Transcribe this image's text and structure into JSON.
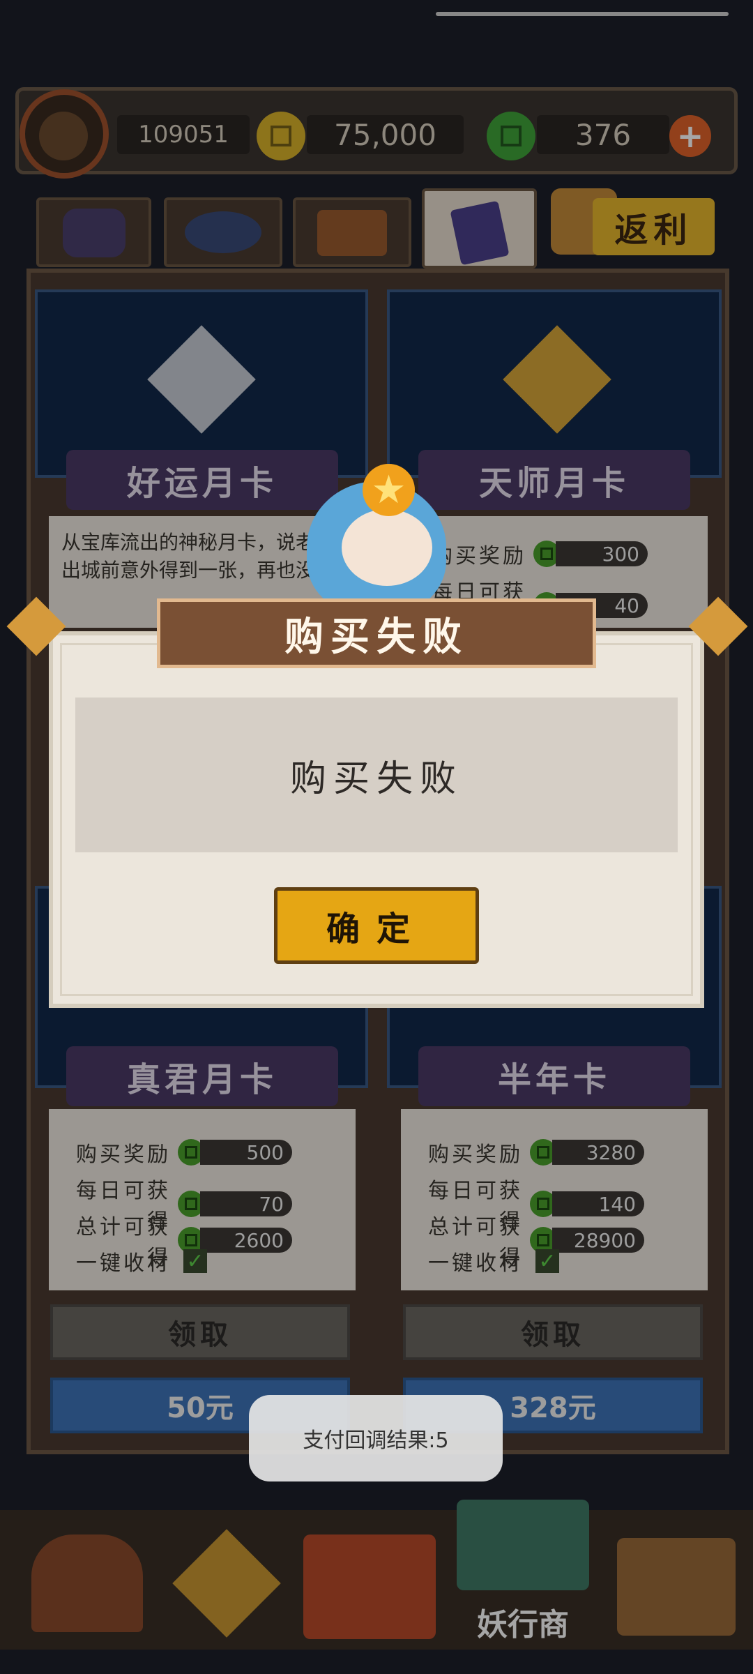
{
  "header": {
    "player_id": "109051",
    "gold": "75,000",
    "jade": "376",
    "add_icon": "plus-icon"
  },
  "tabs": [
    {
      "icon": "demon-icon"
    },
    {
      "icon": "eye-icon"
    },
    {
      "icon": "treasure-chest-icon"
    },
    {
      "icon": "card-icon"
    }
  ],
  "rebate_label": "返利",
  "cards": [
    {
      "title": "好运月卡",
      "desc": "从宝库流出的神秘月卡，说老王出城前意外得到一张，再也没"
    },
    {
      "title": "天师月卡",
      "rows": [
        {
          "label": "购买奖励",
          "value": "300"
        },
        {
          "label": "每日可获得",
          "value": "40"
        }
      ]
    },
    {
      "title": "真君月卡",
      "rows": [
        {
          "label": "购买奖励",
          "value": "500"
        },
        {
          "label": "每日可获得",
          "value": "70"
        },
        {
          "label": "总计可获得",
          "value": "2600"
        }
      ],
      "onekey": "一键收材",
      "claim": "领取",
      "price": "50元"
    },
    {
      "title": "半年卡",
      "rows": [
        {
          "label": "购买奖励",
          "value": "3280"
        },
        {
          "label": "每日可获得",
          "value": "140"
        },
        {
          "label": "总计可获得",
          "value": "28900"
        }
      ],
      "onekey": "一键收材",
      "claim": "领取",
      "price": "328元"
    }
  ],
  "dialog": {
    "title": "购买失败",
    "message": "购买失败",
    "confirm": "确定"
  },
  "toast": "支付回调结果:5",
  "nav": {
    "active_label": "妖行商"
  },
  "colors": {
    "gold_button": "#e5a614",
    "price_button": "#3e74b8",
    "jade_coin": "#4aa02c"
  }
}
